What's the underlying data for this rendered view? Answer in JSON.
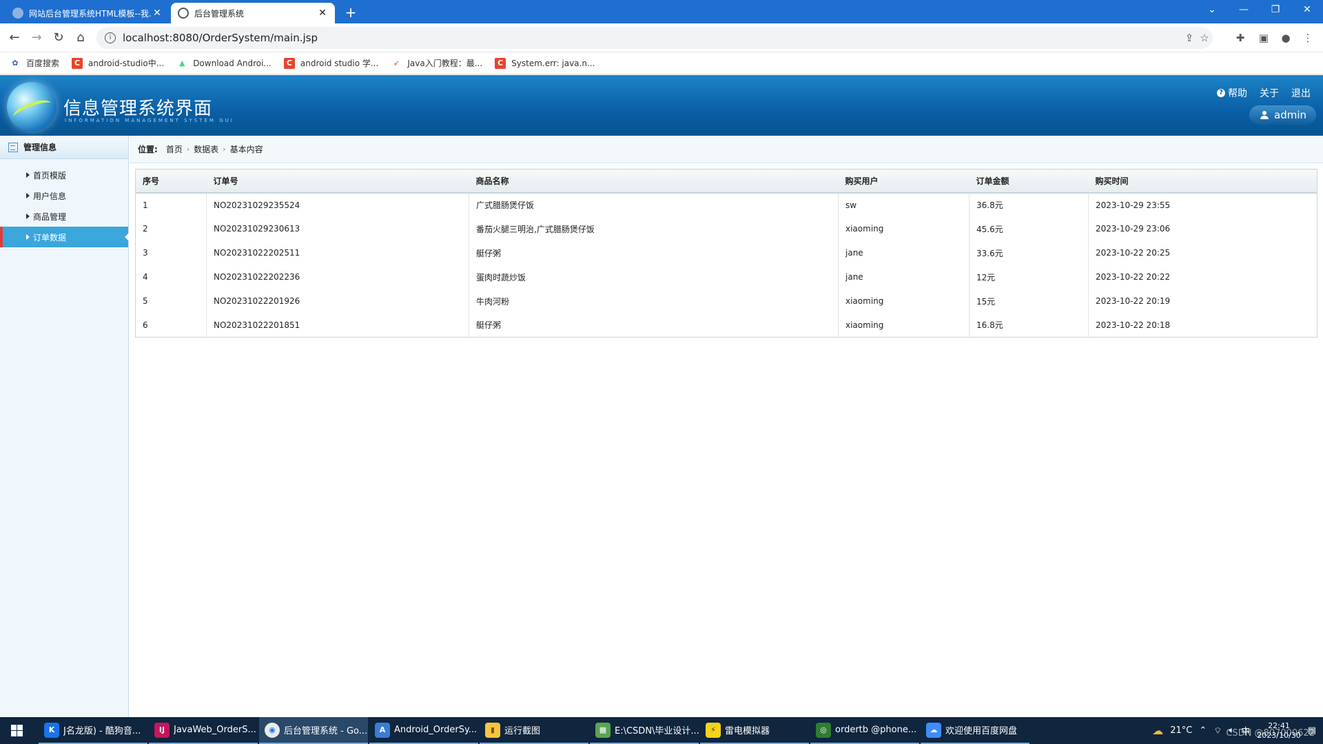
{
  "browser": {
    "tabs": [
      {
        "title": "网站后台管理系统HTML模板--我…",
        "active": false
      },
      {
        "title": "后台管理系统",
        "active": true
      }
    ],
    "url": "localhost:8080/OrderSystem/main.jsp",
    "bookmarks": [
      {
        "label": "百度搜索",
        "icon": "baidu-icon",
        "color": "#2f5bd8",
        "glyph": "✿"
      },
      {
        "label": "android-studio中...",
        "icon": "csdn-icon",
        "color": "#e8452c",
        "glyph": "C"
      },
      {
        "label": "Download Androi...",
        "icon": "android-icon",
        "color": "#3ddc84",
        "glyph": "▲"
      },
      {
        "label": "android studio 学...",
        "icon": "csdn-icon",
        "color": "#e8452c",
        "glyph": "C"
      },
      {
        "label": "Java入门教程：最...",
        "icon": "swift-icon",
        "color": "#e84a2b",
        "glyph": "➶"
      },
      {
        "label": "System.err: java.n...",
        "icon": "csdn-icon",
        "color": "#e8452c",
        "glyph": "C"
      }
    ]
  },
  "header": {
    "title": "信息管理系统界面",
    "subtitle": "INFORMATION MANAGEMENT SYSTEM GUI",
    "links": {
      "help": "帮助",
      "about": "关于",
      "logout": "退出"
    },
    "user": "admin"
  },
  "sidebar": {
    "title": "管理信息",
    "items": [
      {
        "label": "首页模版",
        "active": false
      },
      {
        "label": "用户信息",
        "active": false
      },
      {
        "label": "商品管理",
        "active": false
      },
      {
        "label": "订单数据",
        "active": true
      }
    ]
  },
  "breadcrumb": {
    "prefix": "位置:",
    "items": [
      "首页",
      "数据表",
      "基本内容"
    ]
  },
  "table": {
    "columns": [
      "序号",
      "订单号",
      "商品名称",
      "购买用户",
      "订单金额",
      "购买时间"
    ],
    "rows": [
      [
        "1",
        "NO20231029235524",
        "广式腊肠煲仔饭",
        "sw",
        "36.8元",
        "2023-10-29 23:55"
      ],
      [
        "2",
        "NO20231029230613",
        "番茄火腿三明治,广式腊肠煲仔饭",
        "xiaoming",
        "45.6元",
        "2023-10-29 23:06"
      ],
      [
        "3",
        "NO20231022202511",
        "艇仔粥",
        "jane",
        "33.6元",
        "2023-10-22 20:25"
      ],
      [
        "4",
        "NO20231022202236",
        "蛋肉时蔬炒饭",
        "jane",
        "12元",
        "2023-10-22 20:22"
      ],
      [
        "5",
        "NO20231022201926",
        "牛肉河粉",
        "xiaoming",
        "15元",
        "2023-10-22 20:19"
      ],
      [
        "6",
        "NO20231022201851",
        "艇仔粥",
        "xiaoming",
        "16.8元",
        "2023-10-22 20:18"
      ]
    ]
  },
  "taskbar": {
    "apps": [
      {
        "label": "J名龙版) - 酷狗音...",
        "color": "#1a73e8",
        "glyph": "K",
        "active": false
      },
      {
        "label": "JavaWeb_OrderS...",
        "color": "#c2185b",
        "glyph": "IJ",
        "active": false
      },
      {
        "label": "后台管理系统 - Go...",
        "color": "#e8eaed",
        "glyph": "◉",
        "active": true
      },
      {
        "label": "Android_OrderSy...",
        "color": "#3a7bd5",
        "glyph": "A",
        "active": false
      },
      {
        "label": "运行截图",
        "color": "#f4c542",
        "glyph": "▮",
        "active": false
      },
      {
        "label": "E:\\CSDN\\毕业设计...",
        "color": "#5aa454",
        "glyph": "▦",
        "active": false
      },
      {
        "label": "雷电模拟器",
        "color": "#f7d21b",
        "glyph": "⚡",
        "active": false
      },
      {
        "label": "ordertb @phone...",
        "color": "#2e7d32",
        "glyph": "◎",
        "active": false
      },
      {
        "label": "欢迎使用百度网盘",
        "color": "#3f8cff",
        "glyph": "☁",
        "active": false
      }
    ],
    "weather": "21°C",
    "time": "22:41",
    "date": "2023/10/30",
    "watermark": "CSDN @807000622"
  }
}
